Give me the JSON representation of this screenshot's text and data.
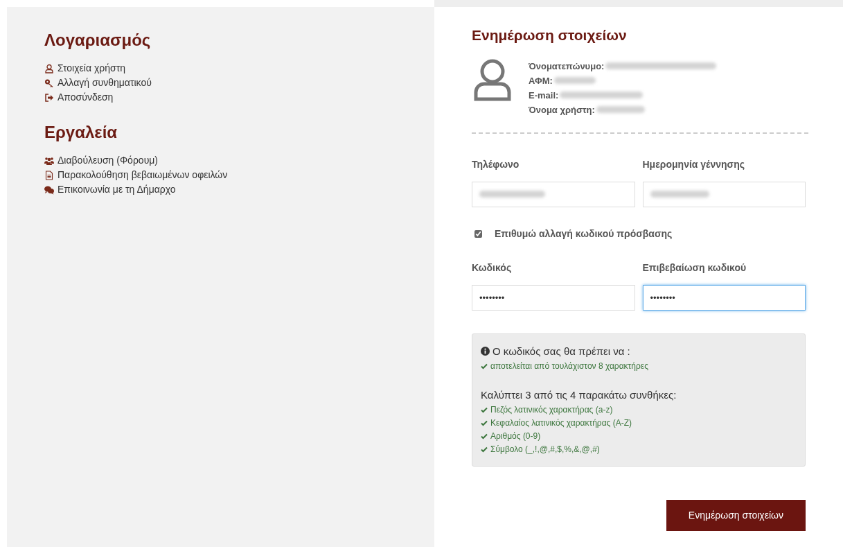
{
  "sidebar": {
    "sections": [
      {
        "title": "Λογαριασμός",
        "items": [
          {
            "kind": "user",
            "label": "Στοιχεία χρήστη"
          },
          {
            "kind": "key",
            "label": "Αλλαγή συνθηματικού"
          },
          {
            "kind": "logout",
            "label": "Αποσύνδεση"
          }
        ]
      },
      {
        "title": "Εργαλεία",
        "items": [
          {
            "kind": "users",
            "label": "Διαβούλευση (Φόρουμ)"
          },
          {
            "kind": "file",
            "label": "Παρακολούθηση βεβαιωμένων οφειλών"
          },
          {
            "kind": "chat",
            "label": "Επικοινωνία με τη Δήμαρχο"
          }
        ]
      }
    ]
  },
  "form": {
    "title": "Ενημέρωση στοιχείων",
    "profile": [
      {
        "label": "Όνοματεπώνυμο:"
      },
      {
        "label": "ΑΦΜ:"
      },
      {
        "label": "E-mail:"
      },
      {
        "label": "Όνομα χρήστη:"
      }
    ],
    "contact_fields": [
      {
        "label": "Τηλέφωνο",
        "focused": false
      },
      {
        "label": "Ημερομηνία γέννησης",
        "focused": false
      }
    ],
    "change_password": {
      "label": "Επιθυμώ αλλαγή κωδικού πρόσβασης",
      "checked": true
    },
    "password_fields": [
      {
        "label": "Κωδικός",
        "value": "••••••••",
        "focused": false
      },
      {
        "label": "Επιβεβαίωση κωδικού",
        "value": "••••••••",
        "focused": true
      }
    ],
    "rules": {
      "title": "Ο κωδικός σας θα πρέπει να :",
      "required": [
        {
          "text": "αποτελείται από τουλάχιστον 8 χαρακτήρες",
          "met": true
        }
      ],
      "subtitle": "Καλύπτει 3 από τις 4 παρακάτω συνθήκες:",
      "optional": [
        {
          "text": "Πεζός λατινικός χαρακτήρας (a-z)",
          "met": true
        },
        {
          "text": "Κεφαλαίος λατινικός χαρακτήρας (A-Z)",
          "met": true
        },
        {
          "text": "Αριθμός (0-9)",
          "met": true
        },
        {
          "text": "Σύμβολο (_,!,@,#,$,%,&,@,#)",
          "met": true
        }
      ]
    },
    "submit": "Ενημέρωση στοιχείων"
  }
}
